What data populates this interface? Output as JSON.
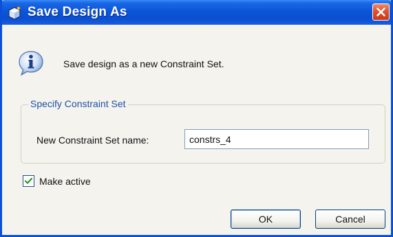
{
  "window": {
    "title": "Save Design As",
    "app_icon": "app-cube-icon",
    "close_icon": "close-icon"
  },
  "message": {
    "icon": "info-icon",
    "text": "Save design as a new Constraint Set."
  },
  "group": {
    "label": "Specify Constraint Set",
    "name_label": "New Constraint Set name:",
    "name_value": "constrs_4"
  },
  "make_active": {
    "label": "Make active",
    "checked": true
  },
  "buttons": {
    "ok": "OK",
    "cancel": "Cancel"
  },
  "colors": {
    "titlebar": "#0a4fd0",
    "close": "#e0502a",
    "dialog_bg": "#f4f3ee",
    "group_label": "#2050a8",
    "check": "#1f9a1f"
  }
}
